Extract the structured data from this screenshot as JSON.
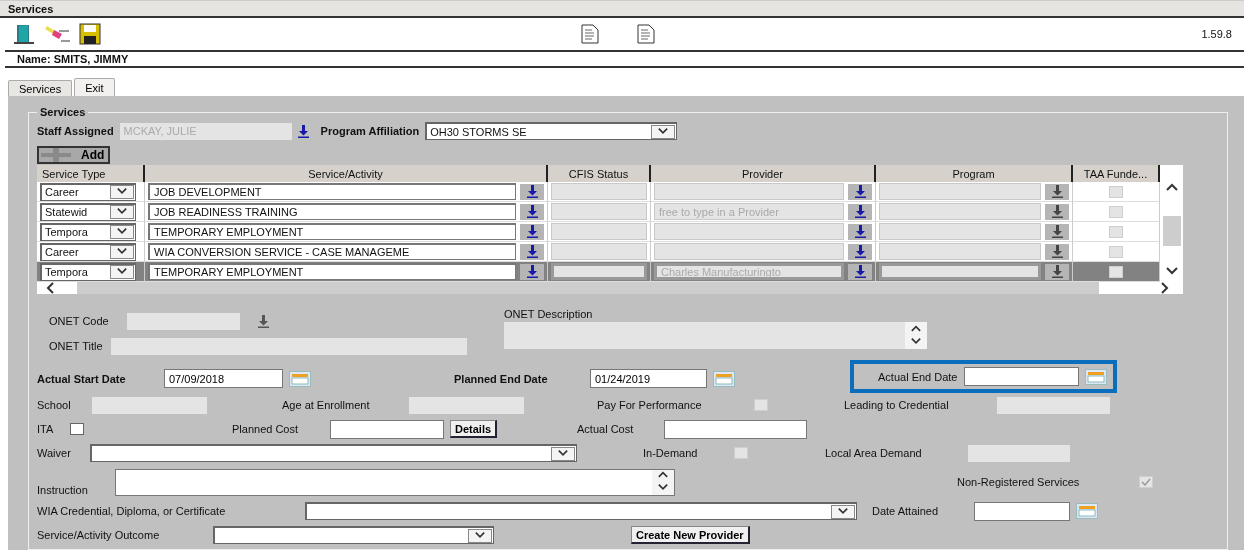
{
  "window": {
    "title": "Services"
  },
  "toolbar": {
    "version": "1.59.8"
  },
  "name_bar": "Name: SMITS, JIMMY",
  "tabs": [
    {
      "label": "Services",
      "selected": true
    },
    {
      "label": "Exit",
      "selected": false
    }
  ],
  "services": {
    "title": "Services",
    "staff_assigned": {
      "label": "Staff Assigned",
      "value": "MCKAY, JULIE"
    },
    "program_affiliation": {
      "label": "Program Affiliation",
      "value": "OH30 STORMS SE"
    },
    "add_button": "Add",
    "table": {
      "columns": [
        "Service Type",
        "Service/Activity",
        "CFIS Status",
        "Provider",
        "Program",
        "TAA Funde..."
      ],
      "rows": [
        {
          "service_type": "Career",
          "service_activity": "JOB DEVELOPMENT",
          "taa_checked": false,
          "selected": false
        },
        {
          "service_type": "Statewid",
          "service_activity": "JOB READINESS TRAINING",
          "provider_placeholder": "free to type in a Provider",
          "taa_checked": false,
          "selected": false
        },
        {
          "service_type": "Tempora",
          "service_activity": "TEMPORARY EMPLOYMENT",
          "taa_checked": false,
          "selected": false
        },
        {
          "service_type": "Career",
          "service_activity": "WIA CONVERSION SERVICE - CASE MANAGEME",
          "taa_checked": false,
          "selected": false
        },
        {
          "service_type": "Tempora",
          "service_activity": "TEMPORARY EMPLOYMENT",
          "provider": "Charles Manufacturingto",
          "taa_checked": false,
          "selected": true
        }
      ]
    },
    "onet": {
      "code_label": "ONET Code",
      "title_label": "ONET Title",
      "description_label": "ONET Description"
    },
    "form_rows": [
      [
        {
          "kind": "date",
          "label": "Actual Start Date",
          "value": "07/09/2018",
          "required": true,
          "highlighted": false
        },
        {
          "kind": "date",
          "label": "Planned End Date",
          "value": "01/24/2019",
          "required": true,
          "highlighted": false
        },
        {
          "kind": "date",
          "label": "Actual End Date",
          "required": false,
          "highlighted": true
        }
      ],
      [
        {
          "kind": "readonly",
          "label": "School"
        },
        {
          "kind": "readonly",
          "label": "Age at Enrollment"
        },
        {
          "kind": "checkbox",
          "label": "Pay For Performance",
          "checked": false,
          "disabled": true
        },
        {
          "kind": "readonly",
          "label": "Leading to Credential"
        }
      ],
      [
        {
          "kind": "checkbox",
          "label": "ITA",
          "checked": false,
          "disabled": false
        },
        {
          "kind": "text",
          "label": "Planned Cost"
        },
        {
          "kind": "button",
          "label": "Details"
        },
        {
          "kind": "text",
          "label": "Actual Cost"
        }
      ],
      [
        {
          "kind": "select",
          "label": "Waiver"
        },
        {
          "kind": "checkbox",
          "label": "In-Demand",
          "checked": false,
          "disabled": true
        },
        {
          "kind": "readonly",
          "label": "Local Area Demand"
        }
      ],
      [
        {
          "kind": "textarea",
          "label": "Instruction"
        },
        {
          "kind": "checkbox",
          "label": "Non-Registered Services",
          "checked": true,
          "disabled": true
        }
      ],
      [
        {
          "kind": "select",
          "label": "WIA Credential, Diploma, or Certificate"
        },
        {
          "kind": "date",
          "label": "Date Attained"
        }
      ],
      [
        {
          "kind": "select",
          "label": "Service/Activity Outcome"
        },
        {
          "kind": "button",
          "label": "Create New Provider"
        }
      ]
    ]
  }
}
